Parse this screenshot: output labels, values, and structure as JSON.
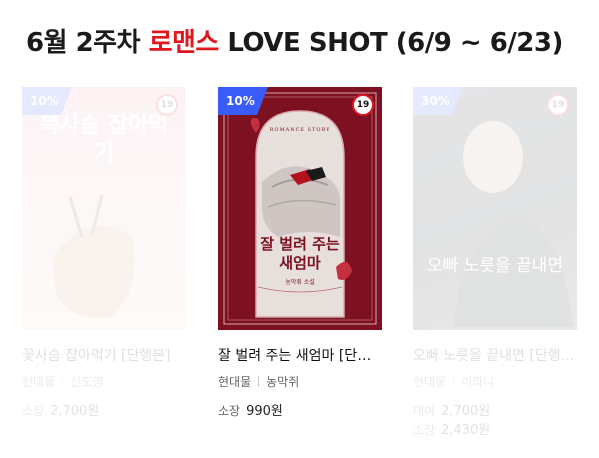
{
  "heading": {
    "prefix": "6월 2주차",
    "genre": "로맨스",
    "suffix": "LOVE SHOT (6/9 ~ 6/23)"
  },
  "books": [
    {
      "discount": "10%",
      "age": "19",
      "cover_title": "복사슴 잡아먹기",
      "title": "꽃사슴 잡아먹기 [단행본]",
      "publisher": "현대물",
      "author": "신도영",
      "price_label": "소장",
      "price": "2,700원"
    },
    {
      "discount": "10%",
      "age": "19",
      "cover_series": "ROMANCE STORY",
      "cover_title": "잘 벌려 주는 새엄마",
      "cover_author": "농막쥐 소설",
      "title": "잘 벌려 주는 새엄마 [단행본]",
      "publisher": "현대물",
      "author": "농막쥐",
      "price_label": "소장",
      "price": "990원"
    },
    {
      "discount": "30%",
      "age": "19",
      "cover_title": "오빠 노릇을 끝내면",
      "title": "오빠 노릇을 끝내면 [단행본]",
      "publisher": "현대물",
      "author": "이라니",
      "rent_label": "대여",
      "rent_price": "2,700원",
      "price_label": "소장",
      "price": "2,430원"
    }
  ],
  "colors": {
    "accent": "#e0171f",
    "badge": "#3b5bf6",
    "cover_red": "#7d1122"
  }
}
